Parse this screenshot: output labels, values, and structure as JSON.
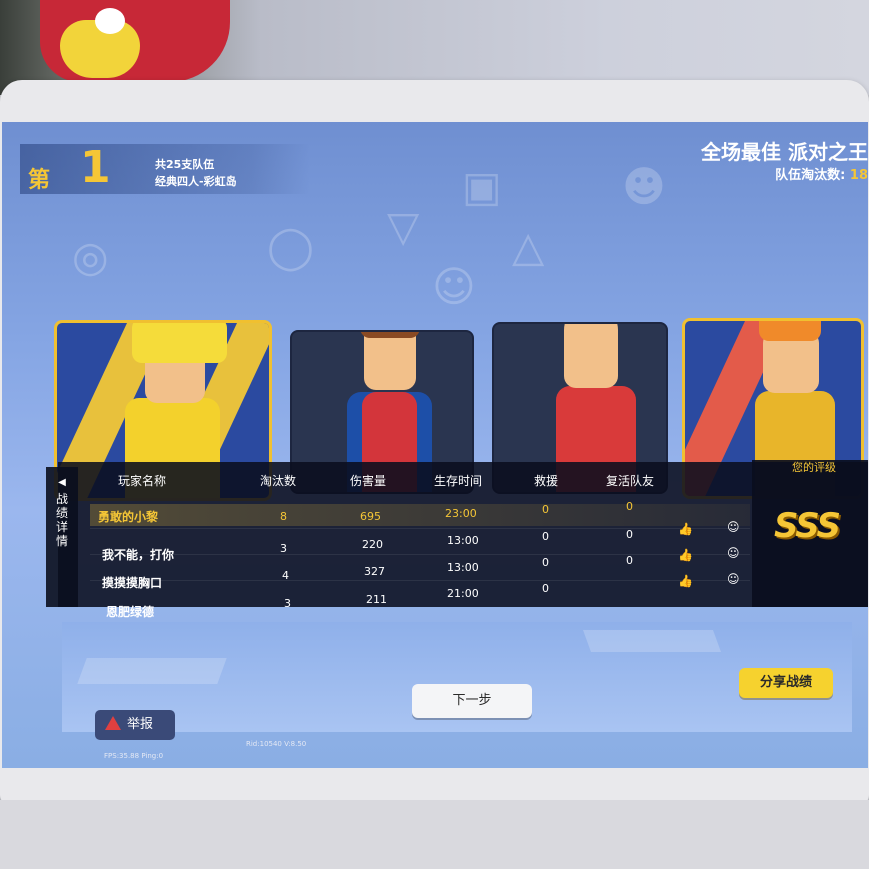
{
  "header": {
    "rank_prefix": "第",
    "rank_number": "1",
    "team_count": "共25支队伍",
    "mode": "经典四人-彩虹岛",
    "best_title": "全场最佳  派对之王",
    "team_elims_label": "队伍淘汰数:",
    "team_elims_value": "18"
  },
  "side_tab": {
    "label": "战绩详情",
    "arrow": "◀"
  },
  "grade": {
    "label": "您的评级",
    "value": "SSS"
  },
  "table": {
    "columns": [
      "玩家名称",
      "淘汰数",
      "伤害量",
      "生存时间",
      "救援",
      "复活队友"
    ],
    "rows": [
      {
        "name": "勇敢的小黎",
        "eliminations": "8",
        "damage": "695",
        "survival": "23:00",
        "rescues": "0",
        "revives": "0",
        "highlight": true
      },
      {
        "name": "我不能，打你",
        "eliminations": "3",
        "damage": "220",
        "survival": "13:00",
        "rescues": "0",
        "revives": "0",
        "highlight": false
      },
      {
        "name": "摸摸摸胸口",
        "eliminations": "4",
        "damage": "327",
        "survival": "13:00",
        "rescues": "0",
        "revives": "0",
        "highlight": false
      },
      {
        "name": "恩肥绿德",
        "eliminations": "3",
        "damage": "211",
        "survival": "21:00",
        "rescues": "0",
        "revives": "",
        "highlight": false
      }
    ]
  },
  "buttons": {
    "next": "下一步",
    "share": "分享战绩",
    "report": "举报"
  },
  "footer": {
    "fps": "FPS:35.88 Ping:0",
    "rid": "Rid:10540 V:8.50"
  },
  "icons": [
    "thumbs-up-icon",
    "add-friend-icon",
    "warning-icon"
  ],
  "colors": {
    "accent_gold": "#f5c636",
    "share_button": "#f6d22e",
    "report_button": "#3a4a78"
  }
}
